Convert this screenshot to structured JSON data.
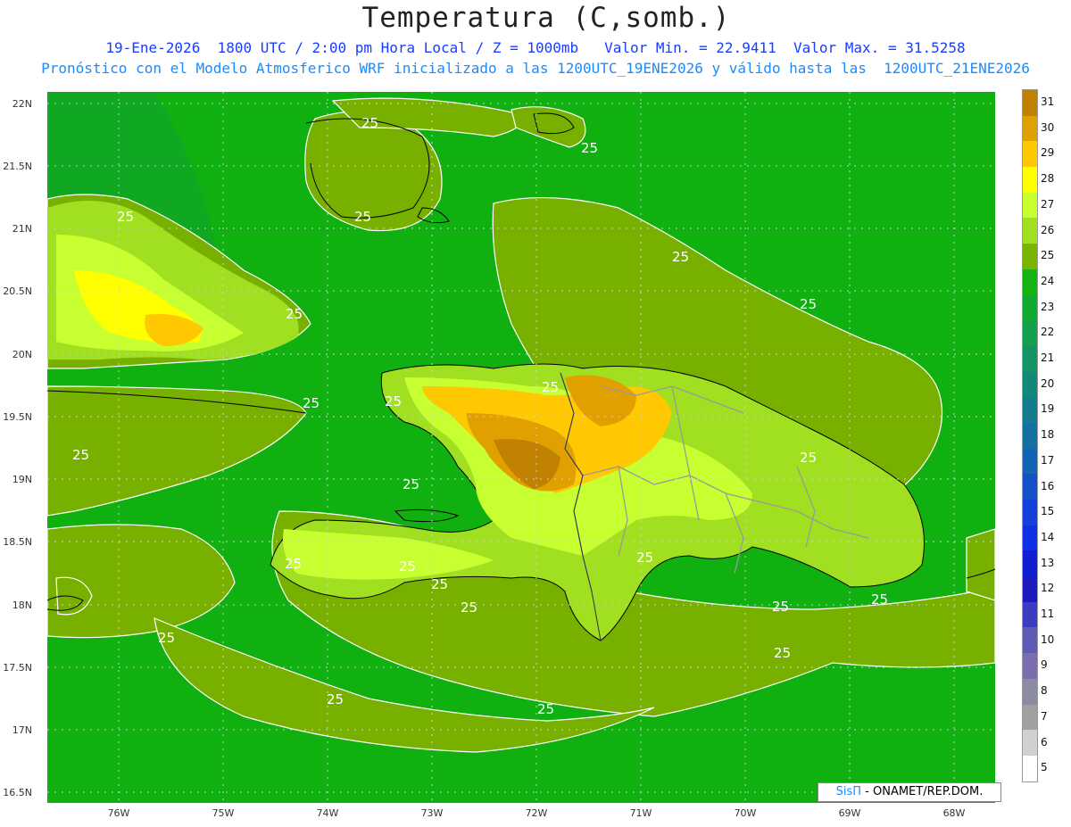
{
  "header": {
    "title": "Temperatura (C,somb.)",
    "line1": "19-Ene-2026  1800 UTC / 2:00 pm Hora Local / Z = 1000mb   Valor Min. = 22.9411  Valor Max. = 31.5258",
    "line2": "Pronóstico con el Modelo Atmosferico WRF inicializado a las 1200UTC_19ENE2026 y válido hasta las  1200UTC_21ENE2026"
  },
  "axes": {
    "lat_labels": [
      "22N",
      "21.5N",
      "21N",
      "20.5N",
      "20N",
      "19.5N",
      "19N",
      "18.5N",
      "18N",
      "17.5N",
      "17N",
      "16.5N"
    ],
    "lon_labels": [
      "76W",
      "75W",
      "74W",
      "73W",
      "72W",
      "71W",
      "70W",
      "69W",
      "68W"
    ]
  },
  "contour_label": "25",
  "colorbar": {
    "labels": [
      "31",
      "30",
      "29",
      "28",
      "27",
      "26",
      "25",
      "24",
      "23",
      "22",
      "21",
      "20",
      "19",
      "18",
      "17",
      "16",
      "15",
      "14",
      "13",
      "12",
      "11",
      "10",
      "9",
      "8",
      "7",
      "6",
      "5"
    ],
    "colors": [
      "#c08000",
      "#e0a000",
      "#ffc800",
      "#ffff00",
      "#c8ff30",
      "#a0e020",
      "#78b400",
      "#14b414",
      "#10aa30",
      "#14a050",
      "#149464",
      "#148878",
      "#147c8c",
      "#1470a0",
      "#1464b4",
      "#1450c8",
      "#1440dc",
      "#1030e6",
      "#1020d0",
      "#1c1cc0",
      "#3c3cc0",
      "#5c5cb4",
      "#7c6cb0",
      "#8c8ca0",
      "#a0a0a0",
      "#d0d0d0",
      "#ffffff"
    ]
  },
  "credit": {
    "brand": "SisΠ",
    "text": "- ONAMET/REP.DOM."
  },
  "colors": {
    "sea": "#10b010",
    "land_low": "#78b000",
    "land_mid": "#a0e020",
    "land_high": "#e0b000",
    "land_peak": "#c88000",
    "title_blue": "#1a3cff",
    "subtitle_blue": "#1a8cff"
  }
}
